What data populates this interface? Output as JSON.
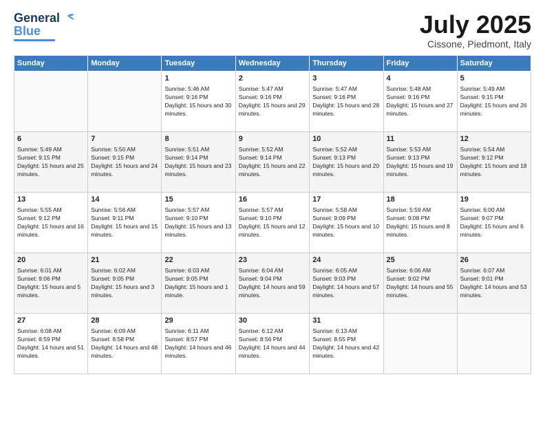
{
  "logo": {
    "general": "General",
    "blue": "Blue"
  },
  "title": "July 2025",
  "location": "Cissone, Piedmont, Italy",
  "days_header": [
    "Sunday",
    "Monday",
    "Tuesday",
    "Wednesday",
    "Thursday",
    "Friday",
    "Saturday"
  ],
  "weeks": [
    [
      {
        "day": "",
        "sunrise": "",
        "sunset": "",
        "daylight": ""
      },
      {
        "day": "",
        "sunrise": "",
        "sunset": "",
        "daylight": ""
      },
      {
        "day": "1",
        "sunrise": "Sunrise: 5:46 AM",
        "sunset": "Sunset: 9:16 PM",
        "daylight": "Daylight: 15 hours and 30 minutes."
      },
      {
        "day": "2",
        "sunrise": "Sunrise: 5:47 AM",
        "sunset": "Sunset: 9:16 PM",
        "daylight": "Daylight: 15 hours and 29 minutes."
      },
      {
        "day": "3",
        "sunrise": "Sunrise: 5:47 AM",
        "sunset": "Sunset: 9:16 PM",
        "daylight": "Daylight: 15 hours and 28 minutes."
      },
      {
        "day": "4",
        "sunrise": "Sunrise: 5:48 AM",
        "sunset": "Sunset: 9:16 PM",
        "daylight": "Daylight: 15 hours and 27 minutes."
      },
      {
        "day": "5",
        "sunrise": "Sunrise: 5:49 AM",
        "sunset": "Sunset: 9:15 PM",
        "daylight": "Daylight: 15 hours and 26 minutes."
      }
    ],
    [
      {
        "day": "6",
        "sunrise": "Sunrise: 5:49 AM",
        "sunset": "Sunset: 9:15 PM",
        "daylight": "Daylight: 15 hours and 25 minutes."
      },
      {
        "day": "7",
        "sunrise": "Sunrise: 5:50 AM",
        "sunset": "Sunset: 9:15 PM",
        "daylight": "Daylight: 15 hours and 24 minutes."
      },
      {
        "day": "8",
        "sunrise": "Sunrise: 5:51 AM",
        "sunset": "Sunset: 9:14 PM",
        "daylight": "Daylight: 15 hours and 23 minutes."
      },
      {
        "day": "9",
        "sunrise": "Sunrise: 5:52 AM",
        "sunset": "Sunset: 9:14 PM",
        "daylight": "Daylight: 15 hours and 22 minutes."
      },
      {
        "day": "10",
        "sunrise": "Sunrise: 5:52 AM",
        "sunset": "Sunset: 9:13 PM",
        "daylight": "Daylight: 15 hours and 20 minutes."
      },
      {
        "day": "11",
        "sunrise": "Sunrise: 5:53 AM",
        "sunset": "Sunset: 9:13 PM",
        "daylight": "Daylight: 15 hours and 19 minutes."
      },
      {
        "day": "12",
        "sunrise": "Sunrise: 5:54 AM",
        "sunset": "Sunset: 9:12 PM",
        "daylight": "Daylight: 15 hours and 18 minutes."
      }
    ],
    [
      {
        "day": "13",
        "sunrise": "Sunrise: 5:55 AM",
        "sunset": "Sunset: 9:12 PM",
        "daylight": "Daylight: 15 hours and 16 minutes."
      },
      {
        "day": "14",
        "sunrise": "Sunrise: 5:56 AM",
        "sunset": "Sunset: 9:11 PM",
        "daylight": "Daylight: 15 hours and 15 minutes."
      },
      {
        "day": "15",
        "sunrise": "Sunrise: 5:57 AM",
        "sunset": "Sunset: 9:10 PM",
        "daylight": "Daylight: 15 hours and 13 minutes."
      },
      {
        "day": "16",
        "sunrise": "Sunrise: 5:57 AM",
        "sunset": "Sunset: 9:10 PM",
        "daylight": "Daylight: 15 hours and 12 minutes."
      },
      {
        "day": "17",
        "sunrise": "Sunrise: 5:58 AM",
        "sunset": "Sunset: 9:09 PM",
        "daylight": "Daylight: 15 hours and 10 minutes."
      },
      {
        "day": "18",
        "sunrise": "Sunrise: 5:59 AM",
        "sunset": "Sunset: 9:08 PM",
        "daylight": "Daylight: 15 hours and 8 minutes."
      },
      {
        "day": "19",
        "sunrise": "Sunrise: 6:00 AM",
        "sunset": "Sunset: 9:07 PM",
        "daylight": "Daylight: 15 hours and 6 minutes."
      }
    ],
    [
      {
        "day": "20",
        "sunrise": "Sunrise: 6:01 AM",
        "sunset": "Sunset: 9:06 PM",
        "daylight": "Daylight: 15 hours and 5 minutes."
      },
      {
        "day": "21",
        "sunrise": "Sunrise: 6:02 AM",
        "sunset": "Sunset: 9:05 PM",
        "daylight": "Daylight: 15 hours and 3 minutes."
      },
      {
        "day": "22",
        "sunrise": "Sunrise: 6:03 AM",
        "sunset": "Sunset: 9:05 PM",
        "daylight": "Daylight: 15 hours and 1 minute."
      },
      {
        "day": "23",
        "sunrise": "Sunrise: 6:04 AM",
        "sunset": "Sunset: 9:04 PM",
        "daylight": "Daylight: 14 hours and 59 minutes."
      },
      {
        "day": "24",
        "sunrise": "Sunrise: 6:05 AM",
        "sunset": "Sunset: 9:03 PM",
        "daylight": "Daylight: 14 hours and 57 minutes."
      },
      {
        "day": "25",
        "sunrise": "Sunrise: 6:06 AM",
        "sunset": "Sunset: 9:02 PM",
        "daylight": "Daylight: 14 hours and 55 minutes."
      },
      {
        "day": "26",
        "sunrise": "Sunrise: 6:07 AM",
        "sunset": "Sunset: 9:01 PM",
        "daylight": "Daylight: 14 hours and 53 minutes."
      }
    ],
    [
      {
        "day": "27",
        "sunrise": "Sunrise: 6:08 AM",
        "sunset": "Sunset: 8:59 PM",
        "daylight": "Daylight: 14 hours and 51 minutes."
      },
      {
        "day": "28",
        "sunrise": "Sunrise: 6:09 AM",
        "sunset": "Sunset: 8:58 PM",
        "daylight": "Daylight: 14 hours and 48 minutes."
      },
      {
        "day": "29",
        "sunrise": "Sunrise: 6:11 AM",
        "sunset": "Sunset: 8:57 PM",
        "daylight": "Daylight: 14 hours and 46 minutes."
      },
      {
        "day": "30",
        "sunrise": "Sunrise: 6:12 AM",
        "sunset": "Sunset: 8:56 PM",
        "daylight": "Daylight: 14 hours and 44 minutes."
      },
      {
        "day": "31",
        "sunrise": "Sunrise: 6:13 AM",
        "sunset": "Sunset: 8:55 PM",
        "daylight": "Daylight: 14 hours and 42 minutes."
      },
      {
        "day": "",
        "sunrise": "",
        "sunset": "",
        "daylight": ""
      },
      {
        "day": "",
        "sunrise": "",
        "sunset": "",
        "daylight": ""
      }
    ]
  ]
}
